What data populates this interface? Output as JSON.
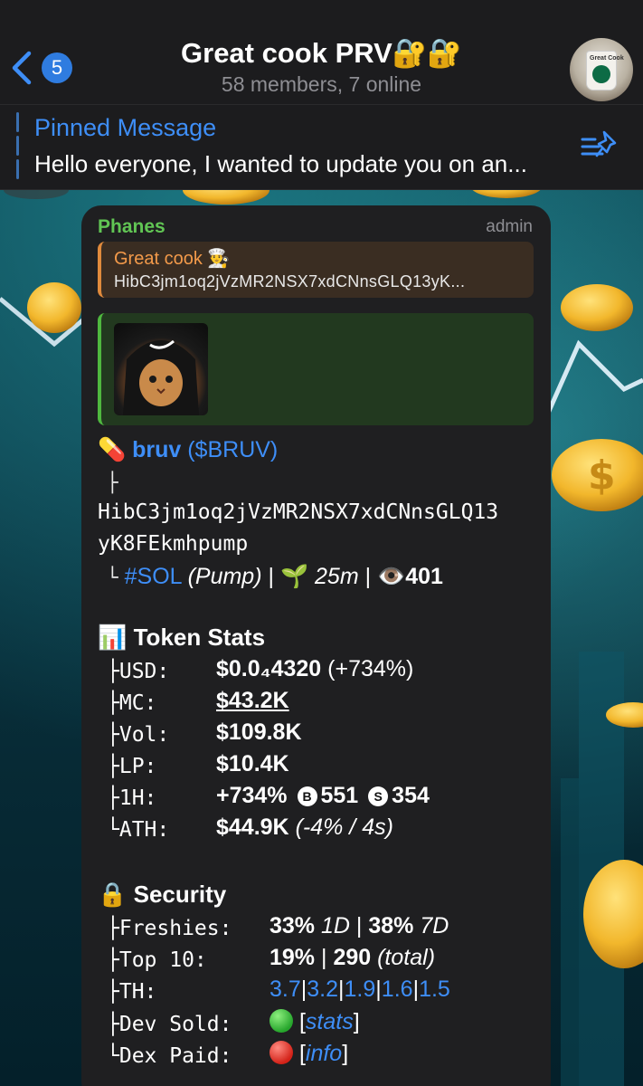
{
  "colors": {
    "header_bg": "#1c1c1e",
    "accent_blue": "#3e8ef7",
    "sender_green": "#61c554",
    "reply_orange": "#f39a4a",
    "bubble_bg": "#1f1f21"
  },
  "header": {
    "back_badge": "5",
    "title": "Great cook PRV🔐🔐",
    "subtitle": "58 members, 7 online",
    "avatar_icon": "coffee-cup-avatar",
    "avatar_text": "Great Cook"
  },
  "pinned": {
    "title": "Pinned Message",
    "text": "Hello everyone, I wanted to update you on an..."
  },
  "message": {
    "sender": "Phanes",
    "role": "admin",
    "reply": {
      "name": "Great cook 👨‍🍳",
      "text": "HibC3jm1oq2jVzMR2NSX7xdCNnsGLQ13yK..."
    },
    "token": {
      "name": "bruv",
      "ticker": "($BRUV)",
      "tree_branch": "├",
      "address_line1": "HibC3jm1oq2jVzMR2NSX7xdCNnsGLQ13",
      "address_line2": "yK8FEkmhpump",
      "tree_end": "└",
      "chain": "#SOL",
      "platform": "(Pump)",
      "age": "25m",
      "views": "401"
    },
    "stats": {
      "title": "Token Stats",
      "usd_label": "├USD:",
      "usd_value": "$0.0₄4320",
      "usd_change": "(+734%)",
      "mc_label": "├MC:",
      "mc_value": "$43.2K",
      "vol_label": "├Vol:",
      "vol_value": "$109.8K",
      "lp_label": "├LP:",
      "lp_value": "$10.4K",
      "h1_label": "├1H:",
      "h1_change": "+734%",
      "h1_buys": "551",
      "h1_sells": "354",
      "ath_label": "└ATH:",
      "ath_value": "$44.9K",
      "ath_note": "(-4% / 4s)"
    },
    "security": {
      "title": "Security",
      "freshies_label": "├Freshies:",
      "freshies_1d": "33%",
      "freshies_1d_unit": "1D",
      "freshies_7d": "38%",
      "freshies_7d_unit": "7D",
      "top10_label": "├Top 10:",
      "top10_pct": "19%",
      "top10_count": "290",
      "top10_note": "(total)",
      "th_label": "├TH:",
      "th_values": [
        "3.7",
        "3.2",
        "1.9",
        "1.6",
        "1.5"
      ],
      "dev_label": "├Dev Sold:",
      "dev_link": "stats",
      "dex_label": "└Dex Paid:",
      "dex_link": "info"
    }
  }
}
